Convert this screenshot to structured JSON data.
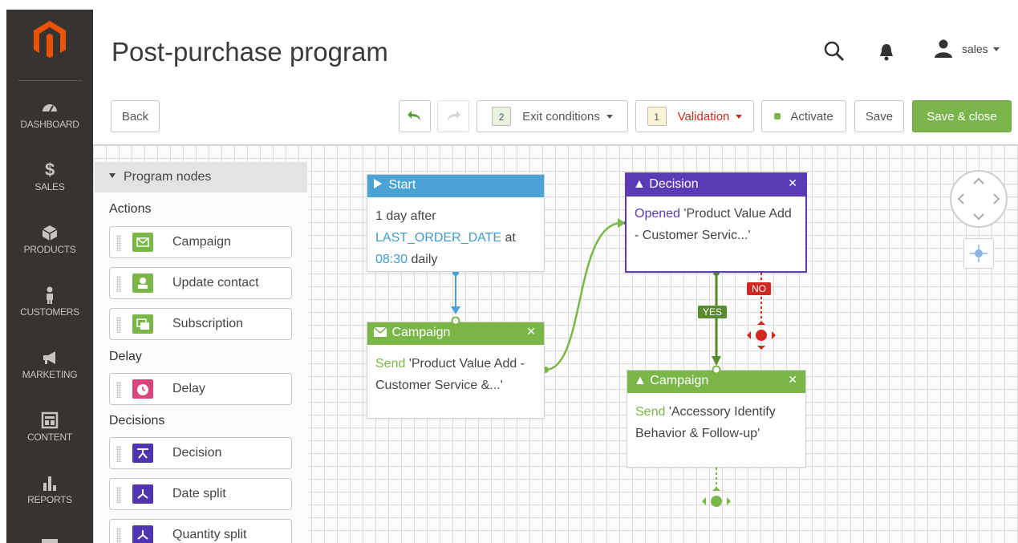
{
  "sidebar": {
    "items": [
      {
        "label": "DASHBOARD",
        "icon": "dashboard-icon"
      },
      {
        "label": "SALES",
        "icon": "dollar-icon"
      },
      {
        "label": "PRODUCTS",
        "icon": "box-icon"
      },
      {
        "label": "CUSTOMERS",
        "icon": "person-icon"
      },
      {
        "label": "MARKETING",
        "icon": "megaphone-icon"
      },
      {
        "label": "CONTENT",
        "icon": "layout-icon"
      },
      {
        "label": "REPORTS",
        "icon": "bar-chart-icon"
      }
    ]
  },
  "header": {
    "title": "Post-purchase program",
    "user": "sales"
  },
  "toolbar": {
    "back": "Back",
    "exit_count": "2",
    "exit_label": "Exit conditions",
    "validation_count": "1",
    "validation_label": "Validation",
    "activate": "Activate",
    "save": "Save",
    "save_close": "Save & close"
  },
  "palette": {
    "title": "Program nodes",
    "sections": {
      "actions": "Actions",
      "delay": "Delay",
      "decisions": "Decisions"
    },
    "items": {
      "campaign": "Campaign",
      "update_contact": "Update contact",
      "subscription": "Subscription",
      "delay": "Delay",
      "decision": "Decision",
      "date_split": "Date split",
      "quantity_split": "Quantity split"
    }
  },
  "nodes": {
    "start": {
      "title": "Start",
      "line1": "1 day after",
      "field": "LAST_ORDER_DATE",
      "at": "at",
      "time": "08:30",
      "freq": "daily"
    },
    "campaign1": {
      "title": "Campaign",
      "verb": "Send",
      "text": "'Product Value Add - Customer Service &...'"
    },
    "decision": {
      "title": "Decision",
      "verb": "Opened",
      "text": "'Product Value Add - Customer Servic...'"
    },
    "campaign2": {
      "title": "Campaign",
      "verb": "Send",
      "text": "'Accessory Identify Behavior & Follow-up'"
    },
    "yes_label": "YES",
    "no_label": "NO"
  },
  "colors": {
    "sidebar_bg": "#373330",
    "brand_orange": "#eb5202",
    "start_blue": "#4aa3d3",
    "campaign_green": "#7ab648",
    "decision_purple": "#5a3bb5",
    "no_red": "#d0281e",
    "validation_red": "#d0281e",
    "save_close_green": "#79b54a"
  }
}
